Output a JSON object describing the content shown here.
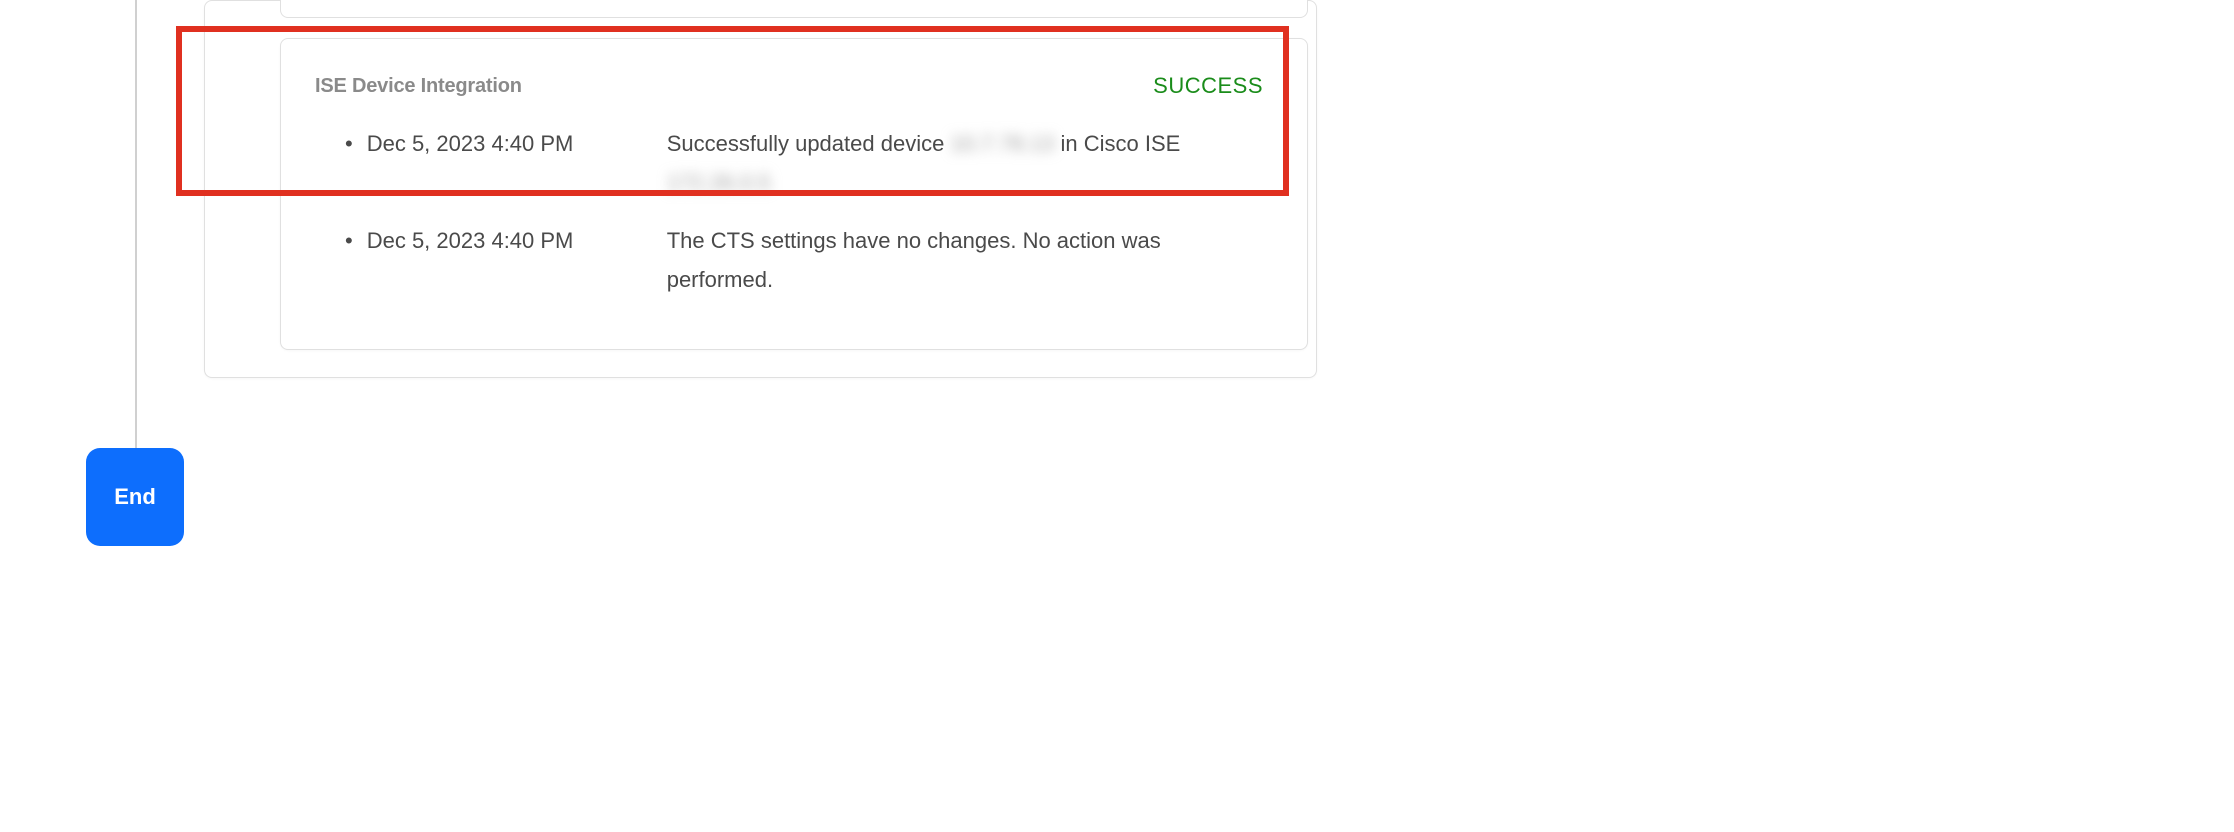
{
  "card": {
    "title": "ISE Device Integration",
    "status": "SUCCESS",
    "logs": [
      {
        "timestamp": "Dec 5, 2023 4:40 PM",
        "message_prefix": "Successfully updated device ",
        "redacted1": "10.7.78.13",
        "message_mid": " in Cisco ISE ",
        "redacted2": "172.26.0.5"
      },
      {
        "timestamp": "Dec 5, 2023 4:40 PM",
        "message": "The CTS settings have no changes. No action was performed."
      }
    ]
  },
  "end_label": "End"
}
